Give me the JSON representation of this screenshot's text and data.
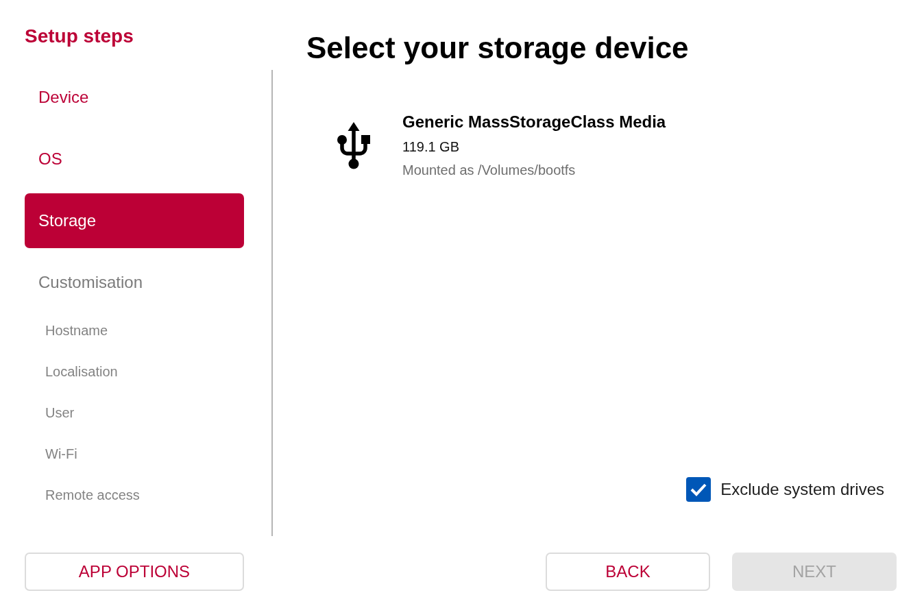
{
  "sidebar": {
    "title": "Setup steps",
    "steps": [
      {
        "label": "Device",
        "selected": false,
        "disabled": false
      },
      {
        "label": "OS",
        "selected": false,
        "disabled": false
      },
      {
        "label": "Storage",
        "selected": true,
        "disabled": false
      },
      {
        "label": "Customisation",
        "selected": false,
        "disabled": true,
        "children": [
          {
            "label": "Hostname",
            "disabled": true
          },
          {
            "label": "Localisation",
            "disabled": true
          },
          {
            "label": "User",
            "disabled": true
          },
          {
            "label": "Wi-Fi",
            "disabled": true
          },
          {
            "label": "Remote access",
            "disabled": true
          }
        ]
      }
    ]
  },
  "main": {
    "title": "Select your storage device",
    "devices": [
      {
        "name": "Generic MassStorageClass Media",
        "size": "119.1 GB",
        "mount": "Mounted as /Volumes/bootfs"
      }
    ],
    "exclude_system_drives": {
      "label": "Exclude system drives",
      "checked": true
    }
  },
  "app_options_button": {
    "label": "APP OPTIONS"
  },
  "nav_buttons": [
    {
      "label": "BACK",
      "disabled": false
    },
    {
      "label": "NEXT",
      "disabled": true
    }
  ]
}
